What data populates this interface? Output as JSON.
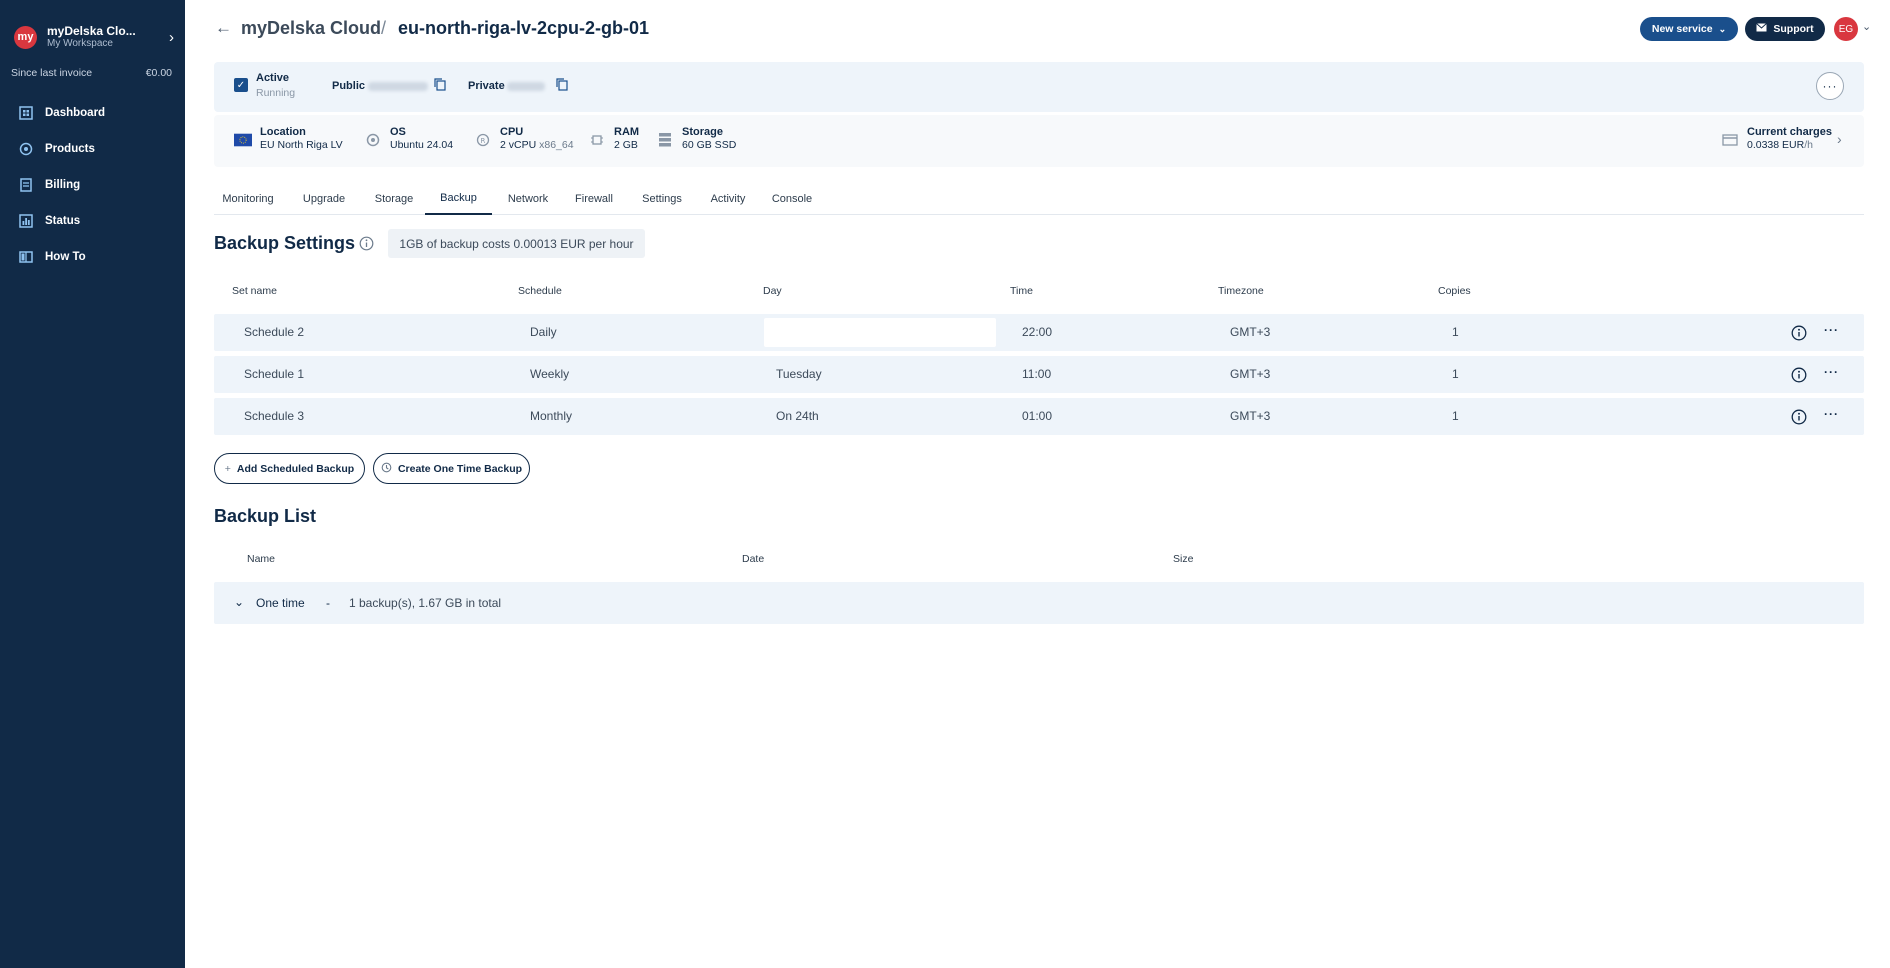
{
  "workspace": {
    "logo": "my",
    "name": "myDelska Clo...",
    "sub": "My Workspace"
  },
  "invoice": {
    "label": "Since last invoice",
    "amount": "€0.00"
  },
  "nav": [
    {
      "label": "Dashboard",
      "icon": "dashboard-icon"
    },
    {
      "label": "Products",
      "icon": "products-icon"
    },
    {
      "label": "Billing",
      "icon": "billing-icon"
    },
    {
      "label": "Status",
      "icon": "status-icon"
    },
    {
      "label": "How To",
      "icon": "book-icon"
    }
  ],
  "header": {
    "breadcrumb_root": "myDelska Cloud",
    "separator": "/",
    "server_name": "eu-north-riga-lv-2cpu-2-gb-01",
    "new_service": "New service",
    "support": "Support",
    "avatar_initials": "EG"
  },
  "status": {
    "state": "Active",
    "substate": "Running",
    "public_label": "Public",
    "private_label": "Private",
    "more": "···"
  },
  "specs": {
    "location": {
      "title": "Location",
      "value": "EU North Riga LV"
    },
    "os": {
      "title": "OS",
      "value": "Ubuntu 24.04"
    },
    "cpu": {
      "title": "CPU",
      "value": "2 vCPU",
      "arch": "x86_64"
    },
    "ram": {
      "title": "RAM",
      "value": "2 GB"
    },
    "storage": {
      "title": "Storage",
      "value": "60 GB SSD"
    },
    "charges": {
      "title": "Current charges",
      "value": "0.0338 EUR",
      "unit": "/h"
    }
  },
  "tabs": [
    "Monitoring",
    "Upgrade",
    "Storage",
    "Backup",
    "Network",
    "Firewall",
    "Settings",
    "Activity",
    "Console"
  ],
  "active_tab": "Backup",
  "backup_settings": {
    "title": "Backup Settings",
    "cost_note": "1GB of backup costs 0.00013 EUR per hour",
    "columns": [
      "Set name",
      "Schedule",
      "Day",
      "Time",
      "Timezone",
      "Copies"
    ],
    "rows": [
      {
        "name": "Schedule 2",
        "schedule": "Daily",
        "day": "",
        "time": "22:00",
        "timezone": "GMT+3",
        "copies": "1"
      },
      {
        "name": "Schedule 1",
        "schedule": "Weekly",
        "day": "Tuesday",
        "time": "11:00",
        "timezone": "GMT+3",
        "copies": "1"
      },
      {
        "name": "Schedule 3",
        "schedule": "Monthly",
        "day": "On 24th",
        "time": "01:00",
        "timezone": "GMT+3",
        "copies": "1"
      }
    ],
    "row_more": "···",
    "add_scheduled": "Add Scheduled Backup",
    "create_one_time": "Create One Time Backup"
  },
  "backup_list": {
    "title": "Backup List",
    "columns": [
      "Name",
      "Date",
      "Size"
    ],
    "groups": [
      {
        "name": "One time",
        "dash": "-",
        "summary": "1 backup(s), 1.67 GB in total"
      }
    ]
  },
  "colors": {
    "sidebar": "#112a47",
    "accent": "#1a4f8c",
    "brand_red": "#d9373f",
    "row_bg": "#eef4fa"
  }
}
